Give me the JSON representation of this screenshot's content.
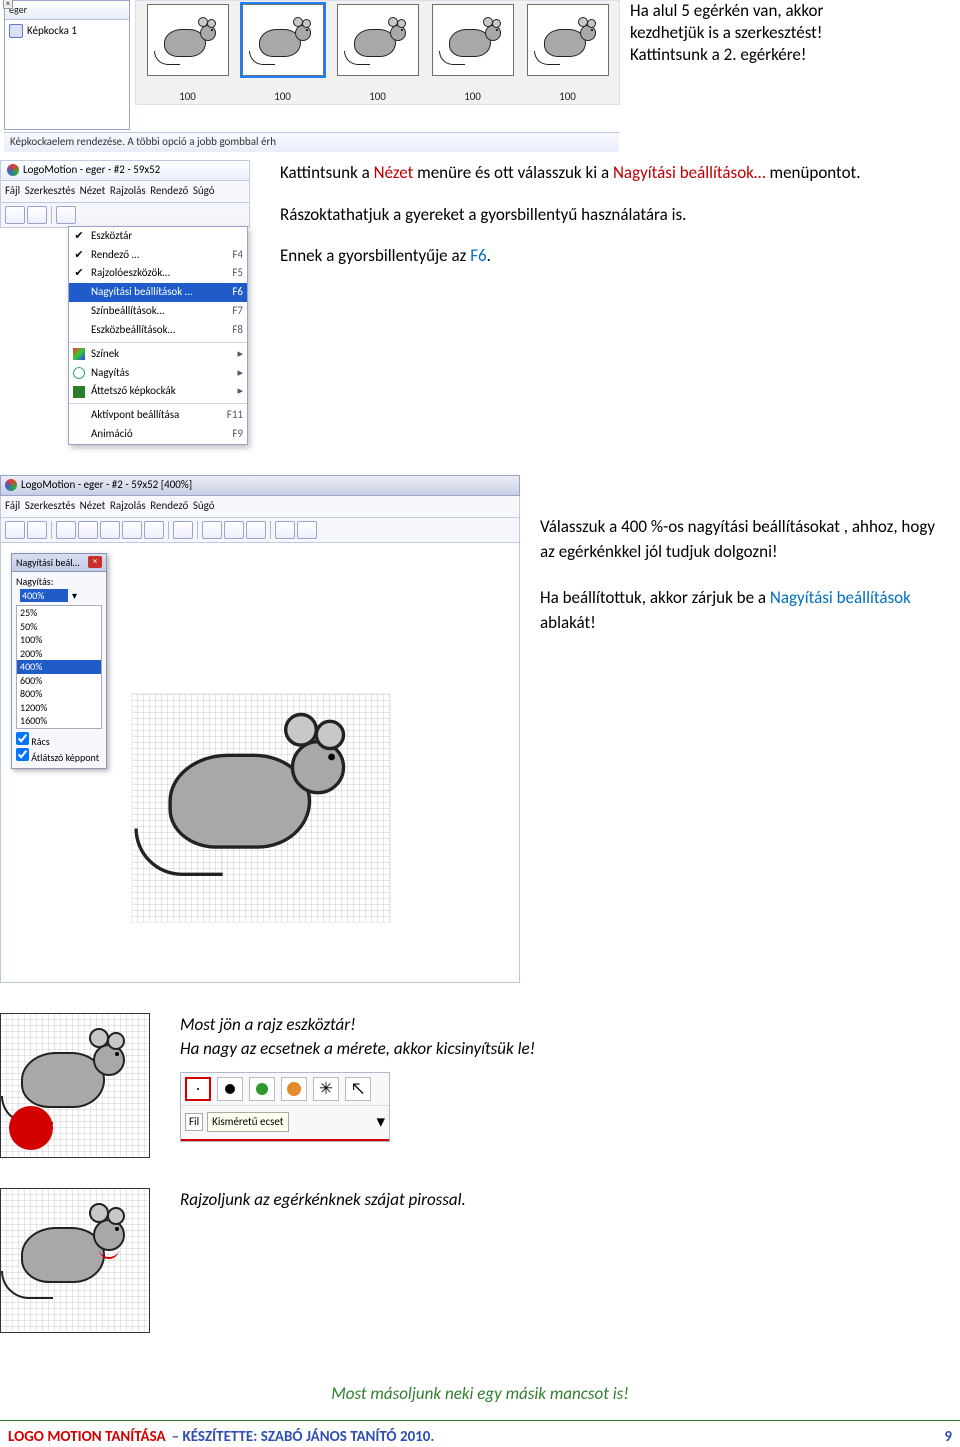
{
  "top": {
    "panel_title": "eger",
    "frame_label": "Képkocka 1",
    "frame_values": [
      "100",
      "100",
      "100",
      "100",
      "100"
    ],
    "text_lines": [
      "Ha alul 5 egérkén van, akkor",
      "kezdhetjük is  a szerkesztést!",
      "Kattintsunk a 2. egérkére!"
    ],
    "status": "Képkockaelem rendezése. A többi opció a jobb gombbal érh"
  },
  "nezet": {
    "app_title": "LogoMotion - eger - #2 - 59x52",
    "menus": [
      "Fájl",
      "Szerkesztés",
      "Nézet",
      "Rajzolás",
      "Rendező",
      "Súgó"
    ],
    "items": [
      {
        "chk": "✔",
        "label": "Eszköztár",
        "sc": ""
      },
      {
        "chk": "✔",
        "label": "Rendező …",
        "sc": "F4"
      },
      {
        "chk": "✔",
        "label": "Rajzolóeszközök…",
        "sc": "F5"
      },
      {
        "chk": "",
        "label": "Nagyítási beállítások …",
        "sc": "F6",
        "hl": true
      },
      {
        "chk": "",
        "label": "Színbeállítások…",
        "sc": "F7"
      },
      {
        "chk": "",
        "label": "Eszközbeállítások…",
        "sc": "F8"
      },
      {
        "sep": true
      },
      {
        "ic": "pal",
        "label": "Színek",
        "arrow": true
      },
      {
        "ic": "mag",
        "label": "Nagyítás",
        "arrow": true
      },
      {
        "ic": "lay",
        "label": "Áttetsző képkockák",
        "arrow": true
      },
      {
        "sep": true
      },
      {
        "label": "Aktívpont beállítása",
        "sc": "F11"
      },
      {
        "label": "Animáció",
        "sc": "F9"
      }
    ],
    "para1_pre": "Kattintsunk a ",
    "para1_red1": "Nézet",
    "para1_mid": " menüre és ott válasszuk ki a ",
    "para1_red2": "Nagyítási beállítások…",
    "para1_post": " menüpontot.",
    "para2": "Rászoktathatjuk a gyereket a gyorsbillentyű használatára is.",
    "para3_pre": "Ennek a gyorsbillentyűje az ",
    "para3_blue": "F6",
    "para3_post": "."
  },
  "zoom": {
    "app_title": "LogoMotion - eger - #2 - 59x52 [400%]",
    "menus": [
      "Fájl",
      "Szerkesztés",
      "Nézet",
      "Rajzolás",
      "Rendező",
      "Súgó"
    ],
    "palette_title": "Nagyítási beál…",
    "palette_label": "Nagyítás:",
    "palette_value": "400%",
    "options": [
      "25%",
      "50%",
      "100%",
      "200%",
      "400%",
      "600%",
      "800%",
      "1200%",
      "1600%"
    ],
    "selected_index": 4,
    "cb1": "Rács",
    "cb2": "Átlátszó képpont",
    "text1": "Válasszuk a 400 %-os nagyítási beállításokat , ahhoz, hogy az egérkénkkel jól tudjuk dolgozni!",
    "text2_pre": "Ha beállítottuk, akkor zárjuk be a ",
    "text2_blue": "Nagyítási beállítások",
    "text2_post": " ablakát!"
  },
  "step_brush": {
    "line1": "Most jön a rajz eszköztár!",
    "line2": "Ha nagy az ecsetnek a mérete, akkor kicsinyítsük le!",
    "fil": "Fil",
    "tooltip": "Kisméretű ecset"
  },
  "step_red": {
    "line": "Rajzoljunk az egérkénknek szájat pirossal."
  },
  "bottom_note": "Most másoljunk neki egy másik mancsot is!",
  "footer": {
    "a": "LOGO MOTION TANÍTÁSA",
    "sep": " – ",
    "b": "KÉSZÍTETTE: SZABÓ JÁNOS TANÍTÓ 2010.",
    "page": "9"
  }
}
